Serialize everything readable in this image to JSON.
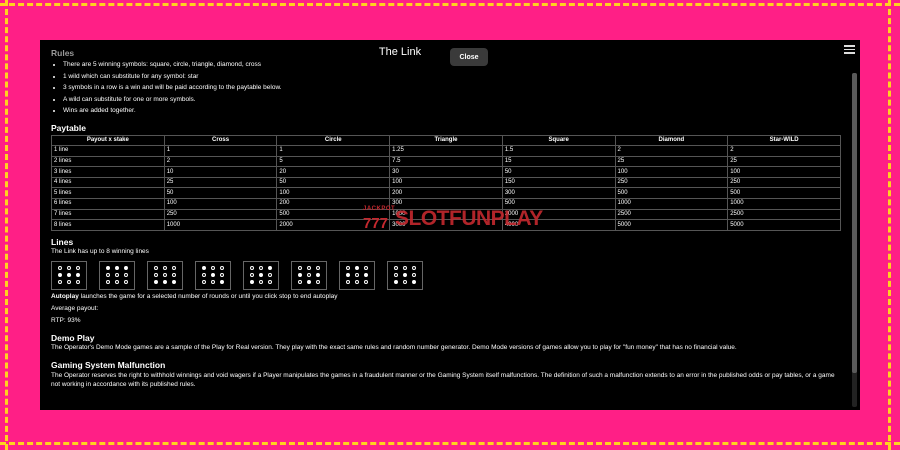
{
  "dialog": {
    "title": "The Link",
    "close_label": "Close",
    "menu_icon": "hamburger-icon"
  },
  "rules": {
    "heading": "Rules",
    "items": [
      "There are 5 winning symbols: square, circle, triangle, diamond, cross",
      "1 wild which can substitute for any symbol: star",
      "3 symbols in a row is a win and will be paid according to the paytable below.",
      "A wild can substitute for one or more symbols.",
      "Wins are added together."
    ]
  },
  "paytable": {
    "heading": "Paytable",
    "headers": [
      "Payout x stake",
      "Cross",
      "Circle",
      "Triangle",
      "Square",
      "Diamond",
      "Star-WILD"
    ],
    "rows": [
      [
        "1 line",
        "1",
        "1",
        "1.25",
        "1.5",
        "2",
        "2"
      ],
      [
        "2 lines",
        "2",
        "5",
        "7.5",
        "15",
        "25",
        "25"
      ],
      [
        "3 lines",
        "10",
        "20",
        "30",
        "50",
        "100",
        "100"
      ],
      [
        "4 lines",
        "25",
        "50",
        "100",
        "150",
        "250",
        "250"
      ],
      [
        "5 lines",
        "50",
        "100",
        "200",
        "300",
        "500",
        "500"
      ],
      [
        "6 lines",
        "100",
        "200",
        "300",
        "500",
        "1000",
        "1000"
      ],
      [
        "7 lines",
        "250",
        "500",
        "1000",
        "2000",
        "2500",
        "2500"
      ],
      [
        "8 lines",
        "1000",
        "2000",
        "3000",
        "4000",
        "5000",
        "5000"
      ]
    ]
  },
  "lines": {
    "heading": "Lines",
    "subtitle": "The Link has up to 8 winning lines",
    "patterns": [
      [
        0,
        0,
        0,
        1,
        1,
        1,
        0,
        0,
        0
      ],
      [
        1,
        1,
        1,
        0,
        0,
        0,
        0,
        0,
        0
      ],
      [
        0,
        0,
        0,
        0,
        0,
        0,
        1,
        1,
        1
      ],
      [
        1,
        0,
        0,
        0,
        1,
        0,
        0,
        0,
        1
      ],
      [
        0,
        0,
        1,
        0,
        1,
        0,
        1,
        0,
        0
      ],
      [
        0,
        0,
        0,
        1,
        0,
        1,
        0,
        1,
        0
      ],
      [
        0,
        1,
        0,
        1,
        0,
        1,
        0,
        0,
        0
      ],
      [
        0,
        0,
        0,
        0,
        1,
        0,
        1,
        0,
        1
      ]
    ]
  },
  "autoplay": {
    "label": "Autoplay",
    "text": " launches the game for a selected number of rounds or until you click stop to end autoplay"
  },
  "average_payout": "Average payout:",
  "rtp": "RTP: 93%",
  "demo": {
    "heading": "Demo Play",
    "text": "The Operator's Demo Mode games are a sample of the Play for Real version. They play with the exact same rules and random number generator. Demo Mode versions of games allow you to play for \"fun money\" that has no financial value."
  },
  "malfunction": {
    "heading": "Gaming System Malfunction",
    "text": "The Operator reserves the right to withhold winnings and void wagers if a Player manipulates the games in a fraudulent manner or the Gaming System itself malfunctions. The definition of such a malfunction extends to an error in the published odds or pay tables, or a game not working in accordance with its published rules."
  },
  "watermark": {
    "top": "JACKPOT",
    "digits": "777",
    "text": "SLOTFUNPLAY"
  },
  "colors": {
    "border": "#ff1f86",
    "dash": "#ffd21f",
    "panel": "#000000",
    "watermark": "#c4282e"
  }
}
